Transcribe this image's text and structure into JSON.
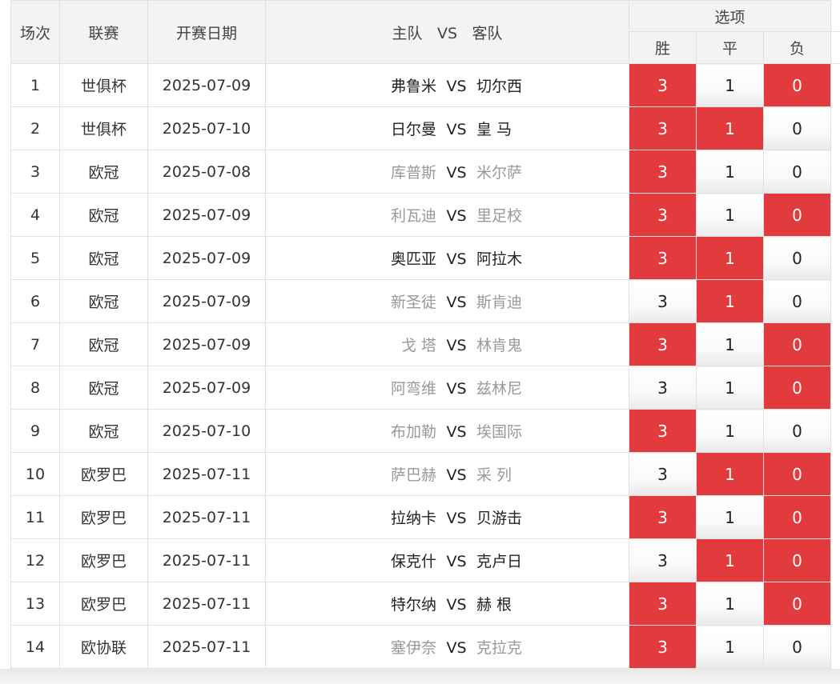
{
  "header": {
    "round": "场次",
    "league": "联赛",
    "date": "开赛日期",
    "home": "主队",
    "vs": "VS",
    "away": "客队",
    "options": "选项",
    "win": "胜",
    "draw": "平",
    "lose": "负"
  },
  "colors": {
    "selected": "#e13b3d",
    "dim_text": "#999999",
    "normal_text": "#222222"
  },
  "rows": [
    {
      "no": "1",
      "league": "世俱杯",
      "date": "2025-07-09",
      "home": "弗鲁米",
      "vs": "VS",
      "away": "切尔西",
      "win": "3",
      "draw": "1",
      "lose": "0",
      "sel_win": true,
      "sel_draw": false,
      "sel_lose": true,
      "dim": false
    },
    {
      "no": "2",
      "league": "世俱杯",
      "date": "2025-07-10",
      "home": "日尔曼",
      "vs": "VS",
      "away": "皇 马",
      "win": "3",
      "draw": "1",
      "lose": "0",
      "sel_win": true,
      "sel_draw": true,
      "sel_lose": false,
      "dim": false
    },
    {
      "no": "3",
      "league": "欧冠",
      "date": "2025-07-08",
      "home": "库普斯",
      "vs": "VS",
      "away": "米尔萨",
      "win": "3",
      "draw": "1",
      "lose": "0",
      "sel_win": true,
      "sel_draw": false,
      "sel_lose": false,
      "dim": true
    },
    {
      "no": "4",
      "league": "欧冠",
      "date": "2025-07-09",
      "home": "利瓦迪",
      "vs": "VS",
      "away": "里足校",
      "win": "3",
      "draw": "1",
      "lose": "0",
      "sel_win": true,
      "sel_draw": false,
      "sel_lose": true,
      "dim": true
    },
    {
      "no": "5",
      "league": "欧冠",
      "date": "2025-07-09",
      "home": "奥匹亚",
      "vs": "VS",
      "away": "阿拉木",
      "win": "3",
      "draw": "1",
      "lose": "0",
      "sel_win": true,
      "sel_draw": true,
      "sel_lose": false,
      "dim": false
    },
    {
      "no": "6",
      "league": "欧冠",
      "date": "2025-07-09",
      "home": "新圣徒",
      "vs": "VS",
      "away": "斯肯迪",
      "win": "3",
      "draw": "1",
      "lose": "0",
      "sel_win": false,
      "sel_draw": true,
      "sel_lose": false,
      "dim": true
    },
    {
      "no": "7",
      "league": "欧冠",
      "date": "2025-07-09",
      "home": "戈 塔",
      "vs": "VS",
      "away": "林肯鬼",
      "win": "3",
      "draw": "1",
      "lose": "0",
      "sel_win": true,
      "sel_draw": false,
      "sel_lose": true,
      "dim": true
    },
    {
      "no": "8",
      "league": "欧冠",
      "date": "2025-07-09",
      "home": "阿弯维",
      "vs": "VS",
      "away": "兹林尼",
      "win": "3",
      "draw": "1",
      "lose": "0",
      "sel_win": false,
      "sel_draw": false,
      "sel_lose": true,
      "dim": true
    },
    {
      "no": "9",
      "league": "欧冠",
      "date": "2025-07-10",
      "home": "布加勒",
      "vs": "VS",
      "away": "埃国际",
      "win": "3",
      "draw": "1",
      "lose": "0",
      "sel_win": true,
      "sel_draw": false,
      "sel_lose": false,
      "dim": true
    },
    {
      "no": "10",
      "league": "欧罗巴",
      "date": "2025-07-11",
      "home": "萨巴赫",
      "vs": "VS",
      "away": "采 列",
      "win": "3",
      "draw": "1",
      "lose": "0",
      "sel_win": false,
      "sel_draw": true,
      "sel_lose": true,
      "dim": true
    },
    {
      "no": "11",
      "league": "欧罗巴",
      "date": "2025-07-11",
      "home": "拉纳卡",
      "vs": "VS",
      "away": "贝游击",
      "win": "3",
      "draw": "1",
      "lose": "0",
      "sel_win": true,
      "sel_draw": false,
      "sel_lose": true,
      "dim": false
    },
    {
      "no": "12",
      "league": "欧罗巴",
      "date": "2025-07-11",
      "home": "保克什",
      "vs": "VS",
      "away": "克卢日",
      "win": "3",
      "draw": "1",
      "lose": "0",
      "sel_win": false,
      "sel_draw": true,
      "sel_lose": true,
      "dim": false
    },
    {
      "no": "13",
      "league": "欧罗巴",
      "date": "2025-07-11",
      "home": "特尔纳",
      "vs": "VS",
      "away": "赫 根",
      "win": "3",
      "draw": "1",
      "lose": "0",
      "sel_win": true,
      "sel_draw": false,
      "sel_lose": true,
      "dim": false
    },
    {
      "no": "14",
      "league": "欧协联",
      "date": "2025-07-11",
      "home": "塞伊奈",
      "vs": "VS",
      "away": "克拉克",
      "win": "3",
      "draw": "1",
      "lose": "0",
      "sel_win": true,
      "sel_draw": false,
      "sel_lose": false,
      "dim": true
    }
  ]
}
